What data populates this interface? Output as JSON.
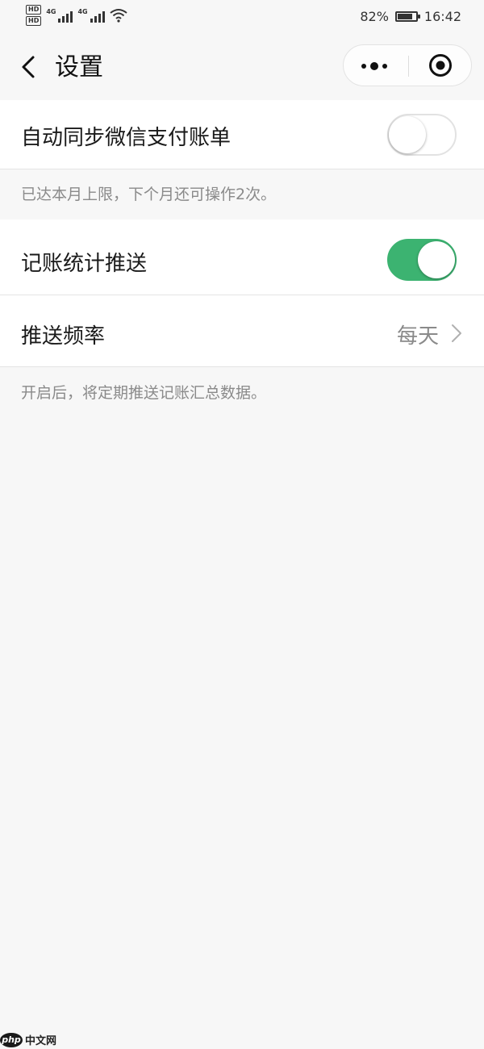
{
  "status_bar": {
    "sim1_badge": "HD",
    "sim2_badge": "HD",
    "network1": "4G",
    "network2": "4G",
    "wifi_icon": "wifi-icon",
    "battery_percent_text": "82%",
    "battery_level": 0.82,
    "time": "16:42"
  },
  "nav": {
    "back_icon": "chevron-left-icon",
    "title": "设置",
    "more_icon": "more-dots-icon",
    "close_icon": "target-circle-icon"
  },
  "settings": {
    "sync_wechat_pay": {
      "label": "自动同步微信支付账单",
      "enabled": false,
      "note": "已达本月上限，下个月还可操作2次。"
    },
    "stats_push": {
      "label": "记账统计推送",
      "enabled": true
    },
    "push_frequency": {
      "label": "推送频率",
      "value": "每天"
    },
    "push_note": "开启后，将定期推送记账汇总数据。"
  },
  "colors": {
    "accent_green": "#3cb371",
    "background": "#f7f7f7",
    "row_background": "#ffffff",
    "secondary_text": "#8a8a8a"
  },
  "watermark": {
    "logo_text": "php",
    "site_text": "中文网"
  }
}
